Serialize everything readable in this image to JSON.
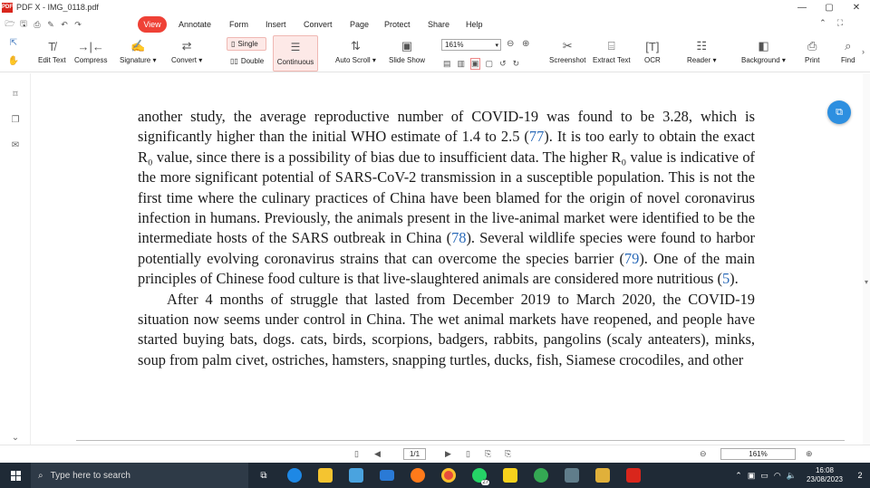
{
  "window": {
    "title": "PDF X - IMG_0118.pdf",
    "logo_text": "PDF",
    "controls": [
      "—",
      "▢",
      "✕"
    ]
  },
  "menu": {
    "items": [
      "View",
      "Annotate",
      "Form",
      "Insert",
      "Convert",
      "Page",
      "Protect",
      "Share",
      "Help"
    ],
    "active": "View"
  },
  "toolbar": {
    "edit_text": "Edit Text",
    "compress": "Compress",
    "signature": "Signature ▾",
    "convert": "Convert ▾",
    "single": "Single",
    "double": "Double",
    "continuous": "Continuous",
    "auto_scroll": "Auto Scroll ▾",
    "slide_show": "Slide Show",
    "zoom_value": "161%",
    "screenshot": "Screenshot",
    "extract_text": "Extract Text",
    "ocr": "OCR",
    "reader": "Reader ▾",
    "background": "Background ▾",
    "print": "Print",
    "find": "Find"
  },
  "document": {
    "paragraph1": [
      {
        "t": "another study, the average reproductive number of COVID-19 was found to be 3.28, which is significantly higher than the initial WHO estimate of 1.4 to 2.5 ("
      },
      {
        "t": "77",
        "ref": true
      },
      {
        "t": "). It is too early to obtain the exact R₀ value, since there is a possibility of bias due to insufficient data. The higher R₀ value is indicative of the more significant potential of SARS-CoV-2 transmission in a susceptible population. This is not the first time where the culinary practices of China have been blamed for the origin of novel coronavirus infection in humans. Previously, the animals present in the live-animal market were identified to be the intermediate hosts of the SARS outbreak in China ("
      },
      {
        "t": "78",
        "ref": true
      },
      {
        "t": "). Several wildlife species were found to harbor potentially evolving coronavirus strains that can overcome the species barrier ("
      },
      {
        "t": "79",
        "ref": true
      },
      {
        "t": "). One of the main principles of Chinese food culture is that live-slaughtered animals are considered more nutritious ("
      },
      {
        "t": "5",
        "ref": true
      },
      {
        "t": ")."
      }
    ],
    "paragraph2": "After 4 months of struggle that lasted from December 2019 to March 2020, the COVID-19 situation now seems under control in China. The wet animal markets have reopened, and people have started buying bats, dogs. cats, birds, scorpions, badgers, rabbits, pangolins (scaly anteaters), minks, soup from palm civet, ostriches, hamsters, snapping turtles, ducks, fish, Siamese crocodiles, and other"
  },
  "statusbar": {
    "page": "1/1",
    "zoom": "161%"
  },
  "taskbar": {
    "search_placeholder": "Type here to search",
    "whatsapp_badge": "27",
    "time": "16:08",
    "date": "23/08/2023",
    "notifications": "2"
  }
}
